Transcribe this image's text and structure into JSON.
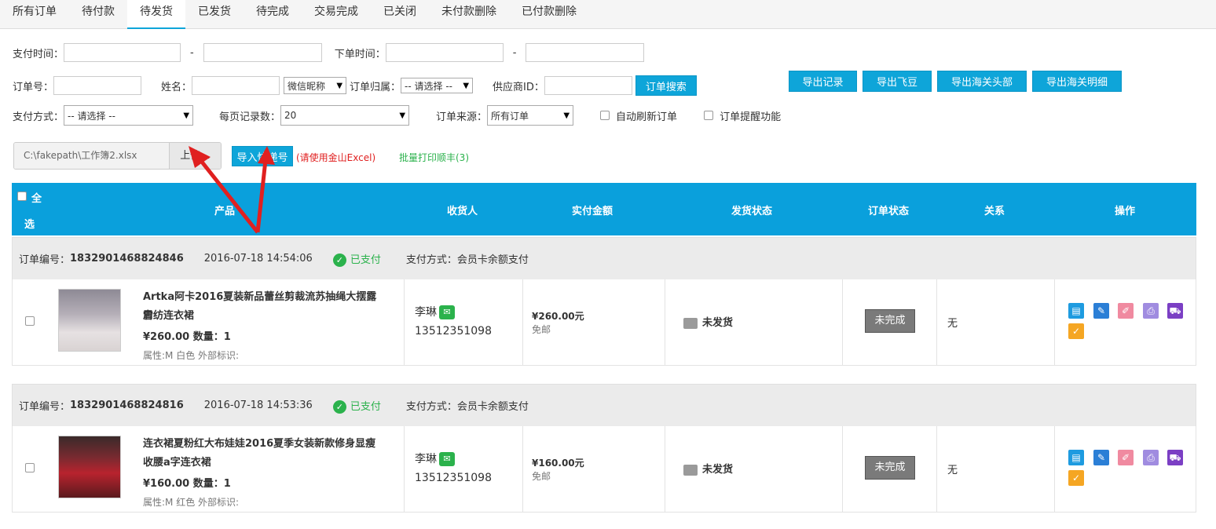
{
  "tabs": [
    "所有订单",
    "待付款",
    "待发货",
    "已发货",
    "待完成",
    "交易完成",
    "已关闭",
    "未付款删除",
    "已付款删除"
  ],
  "filters": {
    "pay_time_label": "支付时间：",
    "order_time_label": "下单时间：",
    "range_dash": "-",
    "order_no_label": "订单号：",
    "name_label": "姓名：",
    "wechat_nick_option": "微信昵称",
    "order_owner_label": "订单归属：",
    "order_owner_value": "-- 请选择 --",
    "supplier_id_label": "供应商ID：",
    "search_button": "订单搜索",
    "pay_method_label": "支付方式：",
    "pay_method_value": "-- 请选择 --",
    "per_page_label": "每页记录数：",
    "per_page_value": "20",
    "order_source_label": "订单来源：",
    "order_source_value": "所有订单",
    "auto_refresh_label": "自动刷新订单",
    "order_reminder_label": "订单提醒功能"
  },
  "export_buttons": [
    "导出记录",
    "导出飞豆",
    "导出海关头部",
    "导出海关明细"
  ],
  "upload": {
    "path": "C:\\fakepath\\工作簿2.xlsx",
    "upload_button": "上传...",
    "import_button": "导入快递号",
    "excel_note": "(请使用金山Excel)",
    "batch_print": "批量打印顺丰(3)"
  },
  "table_header": {
    "select_all_a": "全",
    "select_all_b": "选",
    "product": "产品",
    "receiver": "收货人",
    "paid_amount": "实付金额",
    "ship_status": "发货状态",
    "order_status": "订单状态",
    "relation": "关系",
    "actions": "操作"
  },
  "orders": [
    {
      "order_no_label": "订单编号：",
      "order_no": "1832901468824846",
      "time": "2016-07-18 14:54:06",
      "paid_text": "已支付",
      "pay_method": "支付方式：会员卡余额支付",
      "product_line1": "Artka阿卡2016夏装新品蕾丝剪裁流苏抽绳大摆露肩",
      "product_line2": "雪纺连衣裙",
      "price_qty": "¥260.00 数量：1",
      "attrs": "属性:M 白色 外部标识:",
      "receiver_name": "李琳",
      "receiver_phone": "13512351098",
      "amount": "¥260.00元",
      "shipping": "免邮",
      "ship_status": "未发货",
      "order_status": "未完成",
      "relation": "无"
    },
    {
      "order_no_label": "订单编号：",
      "order_no": "1832901468824816",
      "time": "2016-07-18 14:53:36",
      "paid_text": "已支付",
      "pay_method": "支付方式：会员卡余额支付",
      "product_line1": "连衣裙夏粉红大布娃娃2016夏季女装新款修身显瘦",
      "product_line2": "收腰a字连衣裙",
      "price_qty": "¥160.00 数量：1",
      "attrs": "属性:M 红色 外部标识:",
      "receiver_name": "李琳",
      "receiver_phone": "13512351098",
      "amount": "¥160.00元",
      "shipping": "免邮",
      "ship_status": "未发货",
      "order_status": "未完成",
      "relation": "无"
    }
  ],
  "colors": {
    "accent": "#0aa0dc",
    "paid_green": "#2bb24c",
    "arrow_red": "#e02020"
  }
}
